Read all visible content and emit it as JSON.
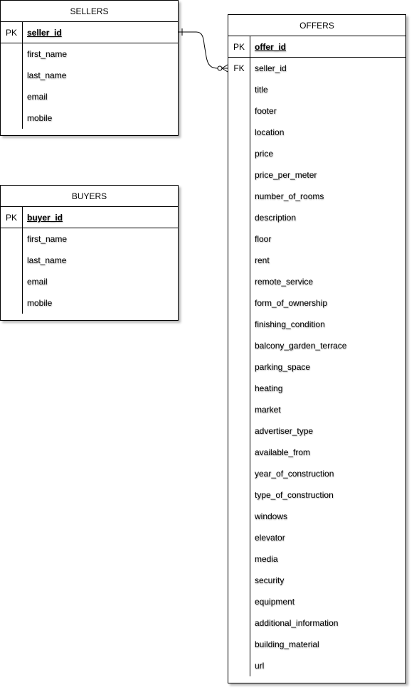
{
  "entities": {
    "sellers": {
      "title": "SELLERS",
      "pk_label": "PK",
      "pk_field": "seller_id",
      "fields": [
        "first_name",
        "last_name",
        "email",
        "mobile"
      ]
    },
    "buyers": {
      "title": "BUYERS",
      "pk_label": "PK",
      "pk_field": "buyer_id",
      "fields": [
        "first_name",
        "last_name",
        "email",
        "mobile"
      ]
    },
    "offers": {
      "title": "OFFERS",
      "pk_label": "PK",
      "pk_field": "offer_id",
      "fk_label": "FK",
      "fields": [
        "seller_id",
        "title",
        "footer",
        "location",
        "price",
        "price_per_meter",
        "number_of_rooms",
        "description",
        "floor",
        "rent",
        "remote_service",
        "form_of_ownership",
        "finishing_condition",
        "balcony_garden_terrace",
        "parking_space",
        "heating",
        "market",
        "advertiser_type",
        "available_from",
        "year_of_construction",
        "type_of_construction",
        "windows",
        "elevator",
        "media",
        "security",
        "equipment",
        "additional_information",
        "building_material",
        "url"
      ]
    }
  },
  "relationships": [
    {
      "from": "sellers.seller_id",
      "to": "offers.seller_id",
      "from_end": "one",
      "to_end": "zero-or-many"
    }
  ]
}
